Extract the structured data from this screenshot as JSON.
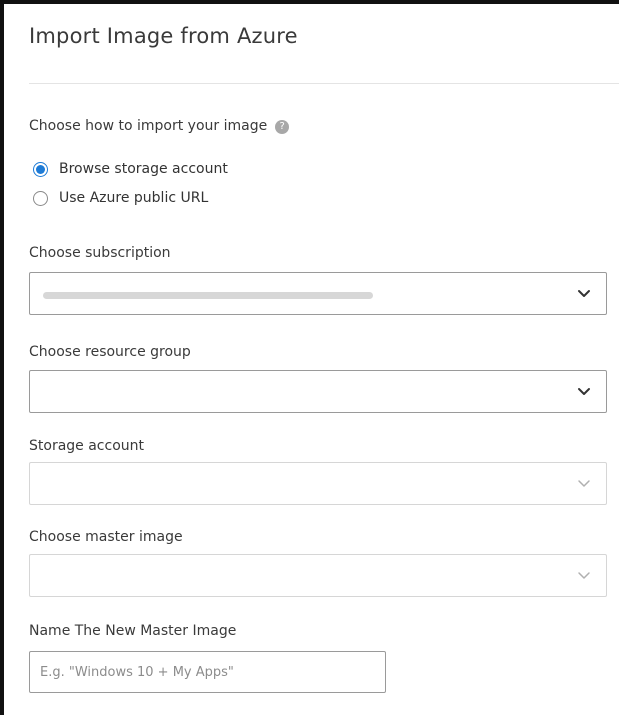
{
  "dialog": {
    "title": "Import Image from Azure"
  },
  "import_method": {
    "label": "Choose how to import your image",
    "help_icon": "?",
    "options": [
      {
        "label": "Browse storage account",
        "selected": true
      },
      {
        "label": "Use Azure public URL",
        "selected": false
      }
    ]
  },
  "subscription": {
    "label": "Choose subscription",
    "value_redacted": true
  },
  "resource_group": {
    "label": "Choose resource group",
    "value": ""
  },
  "storage_account": {
    "label": "Storage account",
    "value": "",
    "disabled": true
  },
  "master_image": {
    "label": "Choose master image",
    "value": "",
    "disabled": true
  },
  "new_master_image_name": {
    "label": "Name The New Master Image",
    "value": "",
    "placeholder": "E.g. \"Windows 10 + My Apps\""
  },
  "colors": {
    "accent": "#1e7bd6",
    "text": "#333333",
    "border": "#9a9a9a",
    "border_disabled": "#d6d6d6"
  }
}
